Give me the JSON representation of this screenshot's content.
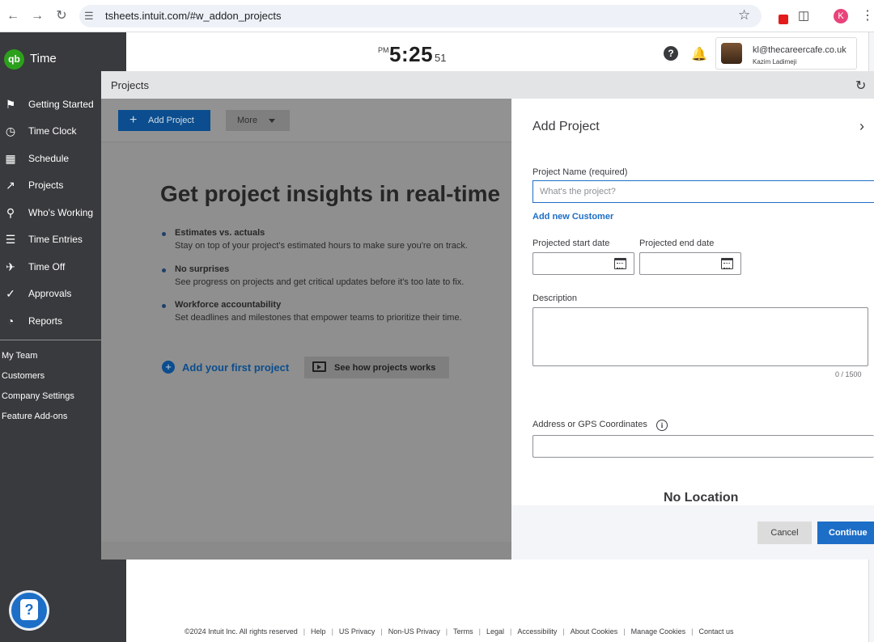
{
  "browser": {
    "url": "tsheets.intuit.com/#w_addon_projects",
    "profile_initial": "K"
  },
  "app": {
    "logo_mark": "qb",
    "logo_text": "Time"
  },
  "sidebar": {
    "items": [
      {
        "label": "Getting Started",
        "icon": "flag-icon"
      },
      {
        "label": "Time Clock",
        "icon": "clock-icon"
      },
      {
        "label": "Schedule",
        "icon": "calendar-icon"
      },
      {
        "label": "Projects",
        "icon": "trend-icon"
      },
      {
        "label": "Who's Working",
        "icon": "map-pin-icon"
      },
      {
        "label": "Time Entries",
        "icon": "list-clock-icon"
      },
      {
        "label": "Time Off",
        "icon": "plane-icon"
      },
      {
        "label": "Approvals",
        "icon": "double-check-icon"
      },
      {
        "label": "Reports",
        "icon": "pie-chart-icon"
      }
    ],
    "secondary": [
      "My Team",
      "Customers",
      "Company Settings",
      "Feature Add-ons"
    ]
  },
  "header": {
    "clock_ampm": "PM",
    "clock_hm": "5:25",
    "clock_sec": "51",
    "user_email": "kl@thecareercafe.co.uk",
    "user_name": "Kazim Ladimeji"
  },
  "projects": {
    "title": "Projects",
    "add_button": "Add Project",
    "more_button": "More",
    "headline": "Get project insights in real-time",
    "bullets": [
      {
        "title": "Estimates vs. actuals",
        "desc": "Stay on top of your project's estimated hours to make sure you're on track."
      },
      {
        "title": "No surprises",
        "desc": "See progress on projects and get critical updates before it's too late to fix."
      },
      {
        "title": "Workforce accountability",
        "desc": "Set deadlines and milestones that empower teams to prioritize their time."
      }
    ],
    "add_first_link": "Add your first project",
    "see_how_button": "See how projects works"
  },
  "drawer": {
    "title": "Add Project",
    "name_label": "Project Name (required)",
    "name_placeholder": "What's the project?",
    "add_customer": "Add new Customer",
    "start_label": "Projected start date",
    "end_label": "Projected end date",
    "description_label": "Description",
    "char_count": "0 / 1500",
    "address_label": "Address or GPS Coordinates",
    "no_location": "No Location",
    "cancel": "Cancel",
    "continue": "Continue"
  },
  "footer": {
    "copyright": "©2024 Intuit Inc. All rights reserved",
    "links": [
      "Help",
      "US Privacy",
      "Non-US Privacy",
      "Terms",
      "Legal",
      "Accessibility",
      "About Cookies",
      "Manage Cookies",
      "Contact us"
    ]
  },
  "colors": {
    "sidebar": "#393a3d",
    "brand_green": "#2ca01c",
    "accent_blue": "#1d6ec6"
  }
}
